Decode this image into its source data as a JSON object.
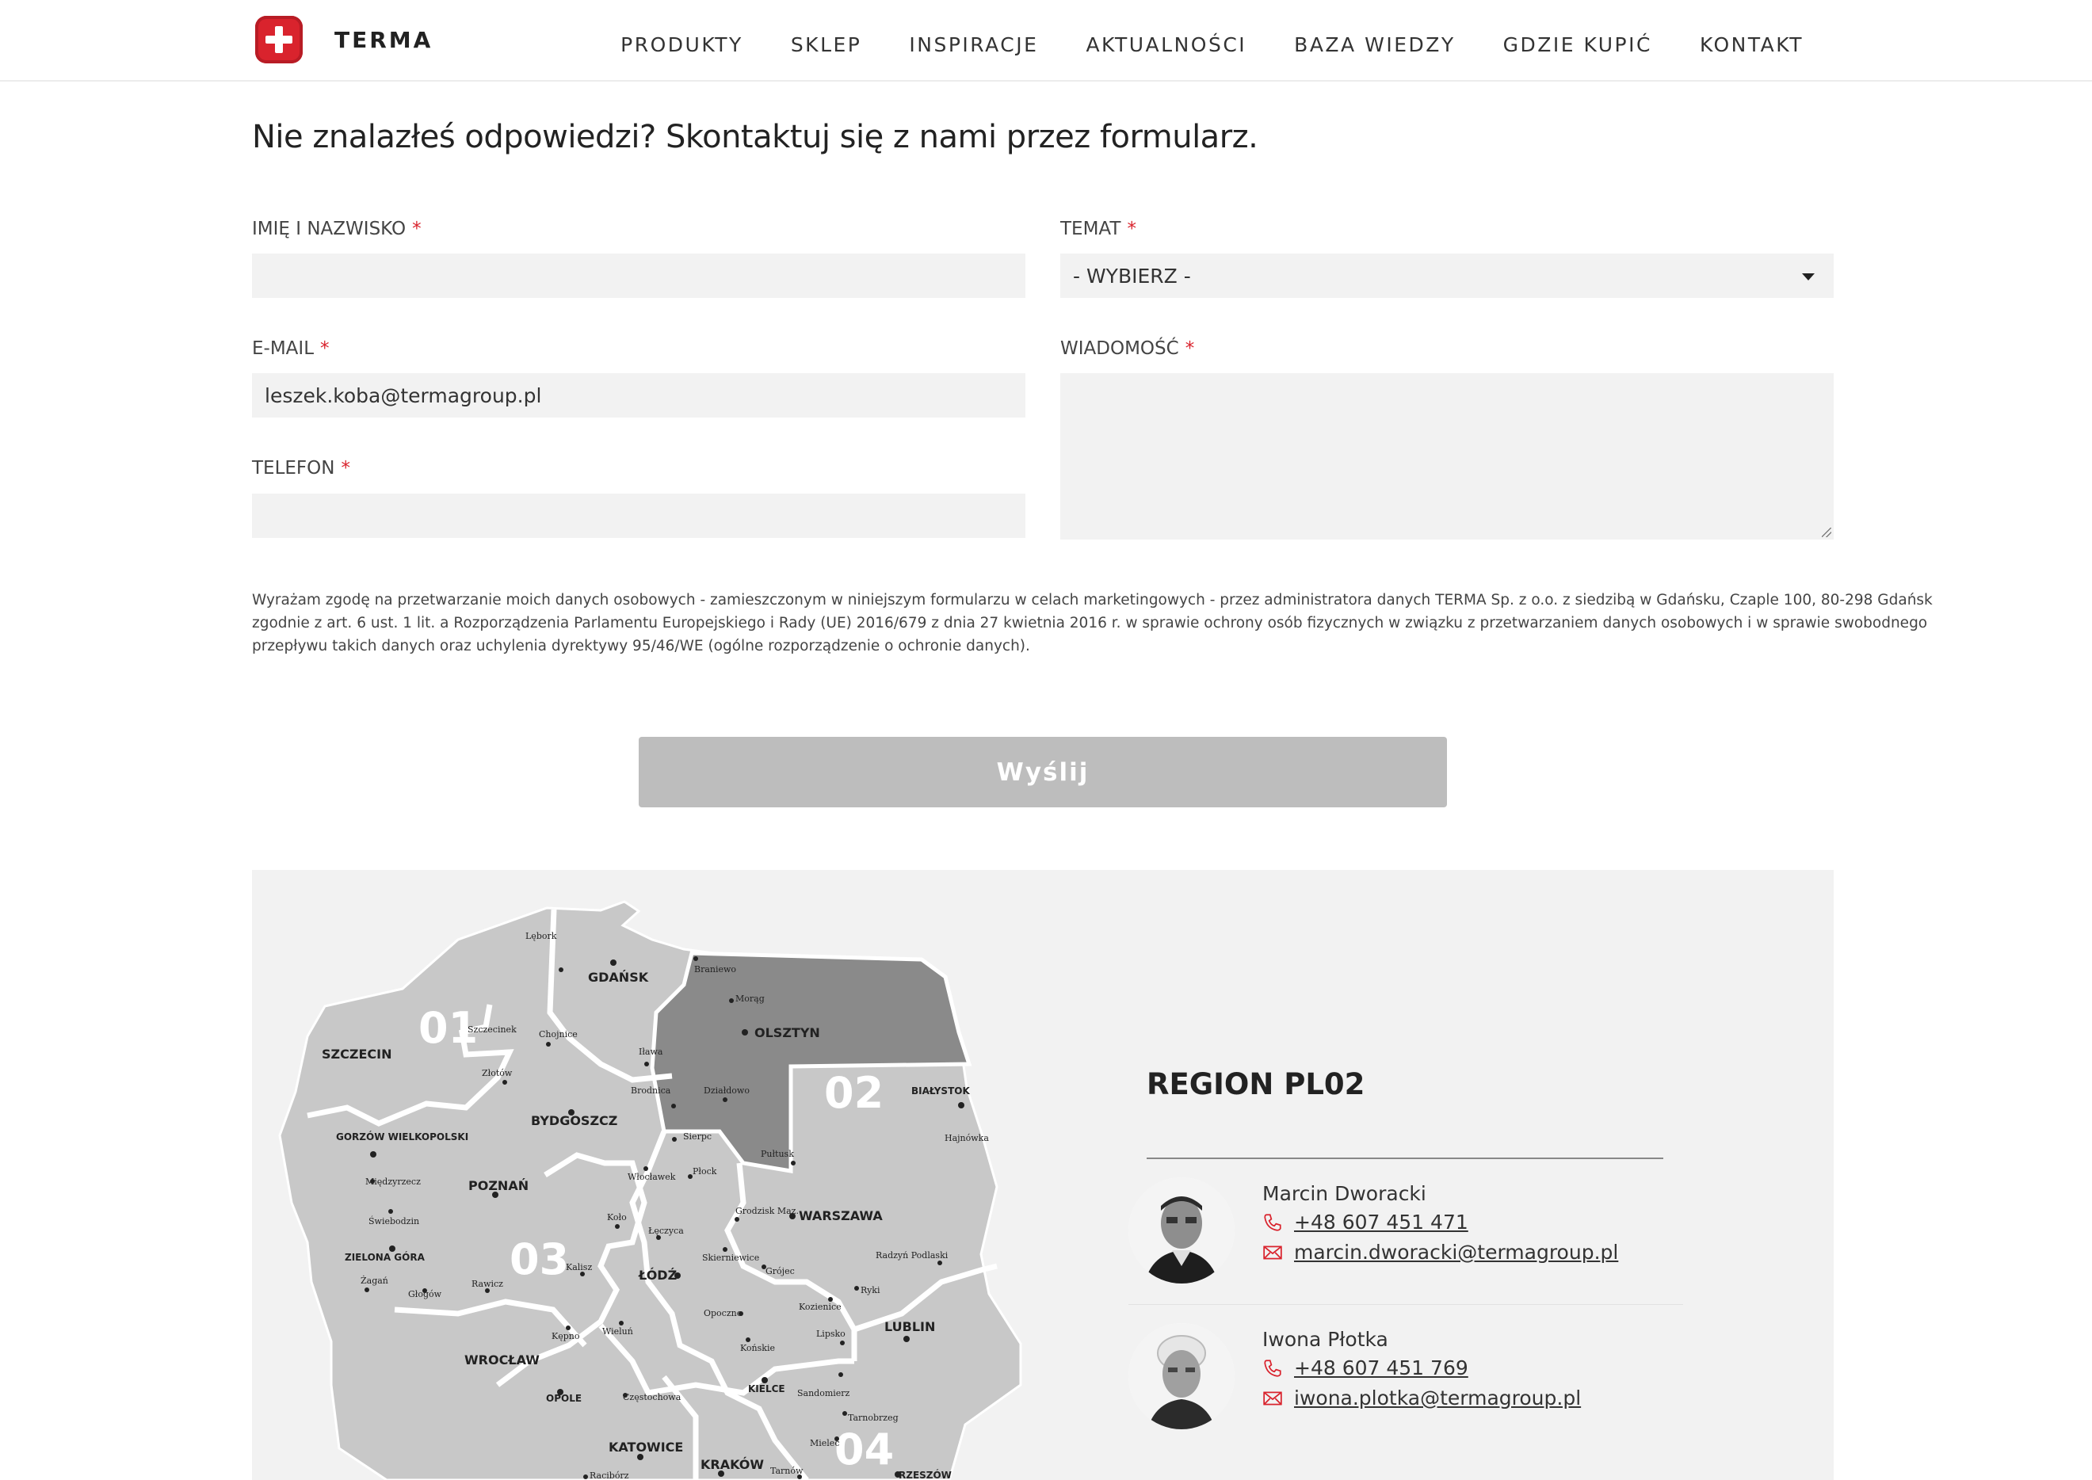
{
  "brand": {
    "name": "TERMA"
  },
  "nav": [
    {
      "label": "PRODUKTY"
    },
    {
      "label": "SKLEP"
    },
    {
      "label": "INSPIRACJE"
    },
    {
      "label": "AKTUALNOŚCI"
    },
    {
      "label": "BAZA WIEDZY"
    },
    {
      "label": "GDZIE KUPIĆ"
    },
    {
      "label": "KONTAKT"
    }
  ],
  "form": {
    "title": "Nie znalazłeś odpowiedzi? Skontaktuj się z nami przez formularz.",
    "name_label": "IMIĘ I NAZWISKO",
    "name_value": "",
    "email_label": "E-MAIL",
    "email_value": "leszek.koba@termagroup.pl",
    "phone_label": "TELEFON",
    "phone_value": "",
    "topic_label": "TEMAT",
    "topic_value": "- WYBIERZ -",
    "message_label": "WIADOMOŚĆ",
    "message_value": "",
    "required_mark": "*",
    "consent_line1": "Wyrażam zgodę na przetwarzanie moich danych osobowych - zamieszczonym w niniejszym formularzu w celach marketingowych - przez administratora danych TERMA Sp. z o.o. z siedzibą w Gdańsku, Czaple 100, 80-298 Gdańsk",
    "consent_line2": "zgodnie z art. 6 ust. 1 lit. a Rozporządzenia Parlamentu Europejskiego i Rady (UE) 2016/679 z dnia 27 kwietnia 2016 r. w sprawie ochrony osób fizycznych w związku z przetwarzaniem danych osobowych i w sprawie swobodnego",
    "consent_line3": "przepływu takich danych oraz uchylenia dyrektywy 95/46/WE (ogólne rozporządzenie o ochronie danych).",
    "submit_label": "Wyślij"
  },
  "map": {
    "regions": [
      "01",
      "02",
      "03",
      "04"
    ],
    "cities_major": [
      "GDAŃSK",
      "OLSZTYN",
      "SZCZECIN",
      "BYDGOSZCZ",
      "BIAŁYSTOK",
      "POZNAŃ",
      "WARSZAWA",
      "GORZÓW WIELKOPOLSKI",
      "ŁÓDŹ",
      "LUBLIN",
      "WROCŁAW",
      "KATOWICE",
      "KRAKÓW",
      "ZIELONA GÓRA",
      "OPOLE",
      "KIELCE",
      "RZESZÓW"
    ],
    "cities_minor": [
      "Lębork",
      "Braniewo",
      "Morąg",
      "Szczecinek",
      "Chojnice",
      "Złotów",
      "Iława",
      "Brodnica",
      "Działdowo",
      "Sierpc",
      "Pułtusk",
      "Hajnówka",
      "Międzyrzecz",
      "Włocławek",
      "Płock",
      "Świebodzin",
      "Koło",
      "Łęczyca",
      "Grodzisk Maz.",
      "Skierniewice",
      "Radzyń Podlaski",
      "Kalisz",
      "Grójec",
      "Żagań",
      "Rawicz",
      "Głogów",
      "Ryki",
      "Opoczno",
      "Kozienice",
      "Kępno",
      "Wieluń",
      "Końskie",
      "Lipsko",
      "Sandomierz",
      "Częstochowa",
      "Tarnobrzeg",
      "Mielec",
      "Racibórz",
      "Tarnów"
    ],
    "active_color": "#8a8a8a",
    "base_color": "#c8c8c8"
  },
  "region": {
    "title": "REGION PL02",
    "contacts": [
      {
        "name": "Marcin Dworacki",
        "phone": "+48 607 451 471",
        "email": "marcin.dworacki@termagroup.pl"
      },
      {
        "name": "Iwona Płotka",
        "phone": "+48 607 451 769",
        "email": "iwona.plotka@termagroup.pl"
      }
    ]
  },
  "colors": {
    "accent": "#d9232d",
    "input_bg": "#f2f2f2",
    "button_bg": "#bdbdbd"
  }
}
